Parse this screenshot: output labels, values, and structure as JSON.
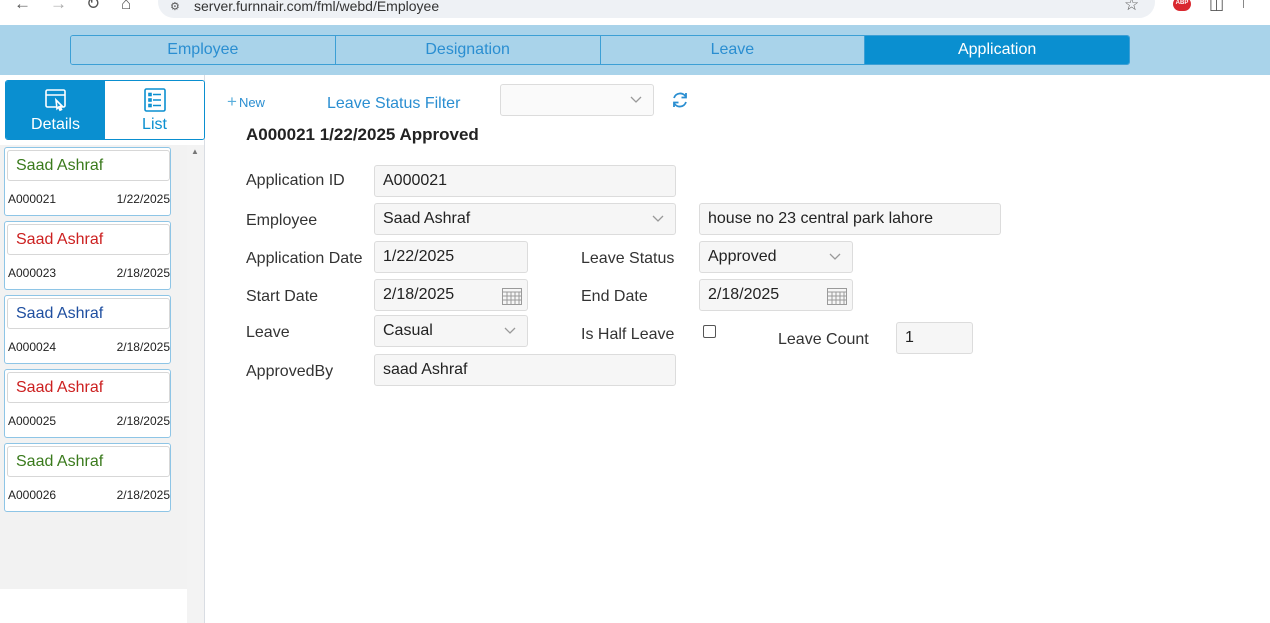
{
  "browser": {
    "url": "server.furnnair.com/fml/webd/Employee"
  },
  "tabs": [
    {
      "label": "Employee",
      "active": false
    },
    {
      "label": "Designation",
      "active": false
    },
    {
      "label": "Leave",
      "active": false
    },
    {
      "label": "Application",
      "active": true
    }
  ],
  "view_switch": {
    "details_label": "Details",
    "list_label": "List"
  },
  "cards": [
    {
      "name": "Saad Ashraf",
      "id": "A000021",
      "date": "1/22/2025",
      "name_color": "#3a7a1c"
    },
    {
      "name": "Saad Ashraf",
      "id": "A000023",
      "date": "2/18/2025",
      "name_color": "#cc2020"
    },
    {
      "name": "Saad Ashraf",
      "id": "A000024",
      "date": "2/18/2025",
      "name_color": "#1f4fa0"
    },
    {
      "name": "Saad Ashraf",
      "id": "A000025",
      "date": "2/18/2025",
      "name_color": "#cc2020"
    },
    {
      "name": "Saad Ashraf",
      "id": "A000026",
      "date": "2/18/2025",
      "name_color": "#3a7a1c"
    }
  ],
  "toolbar": {
    "new_label": "New",
    "filter_label": "Leave Status Filter",
    "filter_value": ""
  },
  "record_title": "A000021 1/22/2025 Approved",
  "form": {
    "application_id_label": "Application ID",
    "application_id": "A000021",
    "employee_label": "Employee",
    "employee": "Saad Ashraf",
    "employee_address": "house no 23 central park lahore",
    "application_date_label": "Application Date",
    "application_date": "1/22/2025",
    "leave_status_label": "Leave Status",
    "leave_status": "Approved",
    "start_date_label": "Start Date",
    "start_date": "2/18/2025",
    "end_date_label": "End Date",
    "end_date": "2/18/2025",
    "leave_label": "Leave",
    "leave": "Casual",
    "is_half_leave_label": "Is Half Leave",
    "is_half_leave": false,
    "leave_count_label": "Leave Count",
    "leave_count": "1",
    "approved_by_label": "ApprovedBy",
    "approved_by": "saad Ashraf"
  },
  "colors": {
    "accent": "#0a8fd0",
    "tabstrip_bg": "#a9d3ea",
    "link": "#2a8ed1"
  }
}
